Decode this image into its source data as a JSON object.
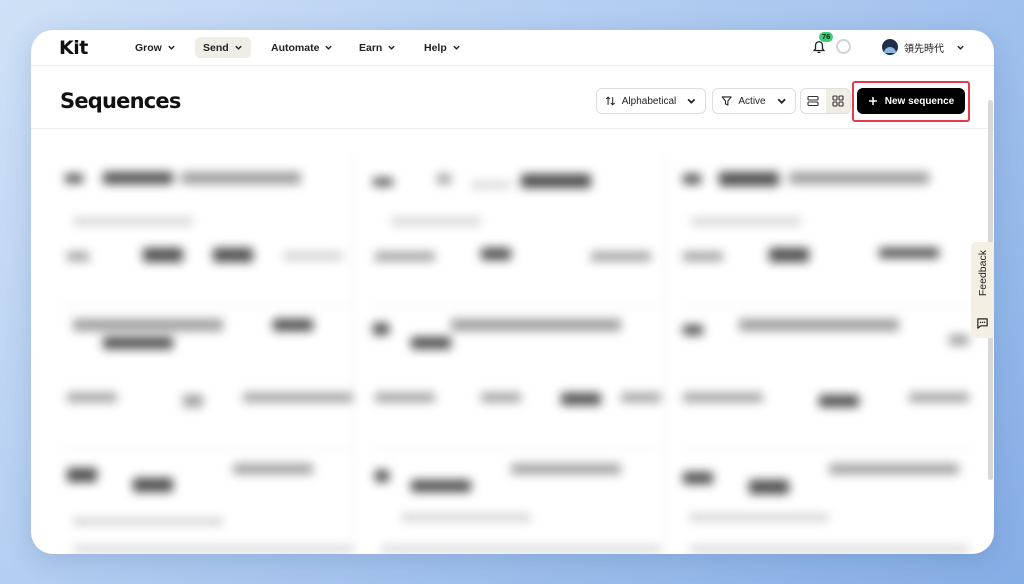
{
  "brand": {
    "logo": "Kit"
  },
  "nav": {
    "items": [
      {
        "label": "Grow",
        "active": false
      },
      {
        "label": "Send",
        "active": true
      },
      {
        "label": "Automate",
        "active": false
      },
      {
        "label": "Earn",
        "active": false
      },
      {
        "label": "Help",
        "active": false
      }
    ]
  },
  "notifications": {
    "count": "76",
    "badge_color": "#3fc97b"
  },
  "account": {
    "name": "領先時代"
  },
  "header": {
    "title": "Sequences",
    "sort_label": "Alphabetical",
    "filter_label": "Active",
    "new_button_label": "New sequence"
  },
  "feedback": {
    "label": "Feedback"
  },
  "colors": {
    "highlight": "#e53a4a",
    "primary_button": "#000000",
    "active_nav": "#efede6"
  },
  "icons": [
    "bell-icon",
    "sort-icon",
    "filter-icon",
    "list-view-icon",
    "grid-view-icon",
    "plus-icon",
    "chevron-down-icon",
    "chat-icon"
  ]
}
